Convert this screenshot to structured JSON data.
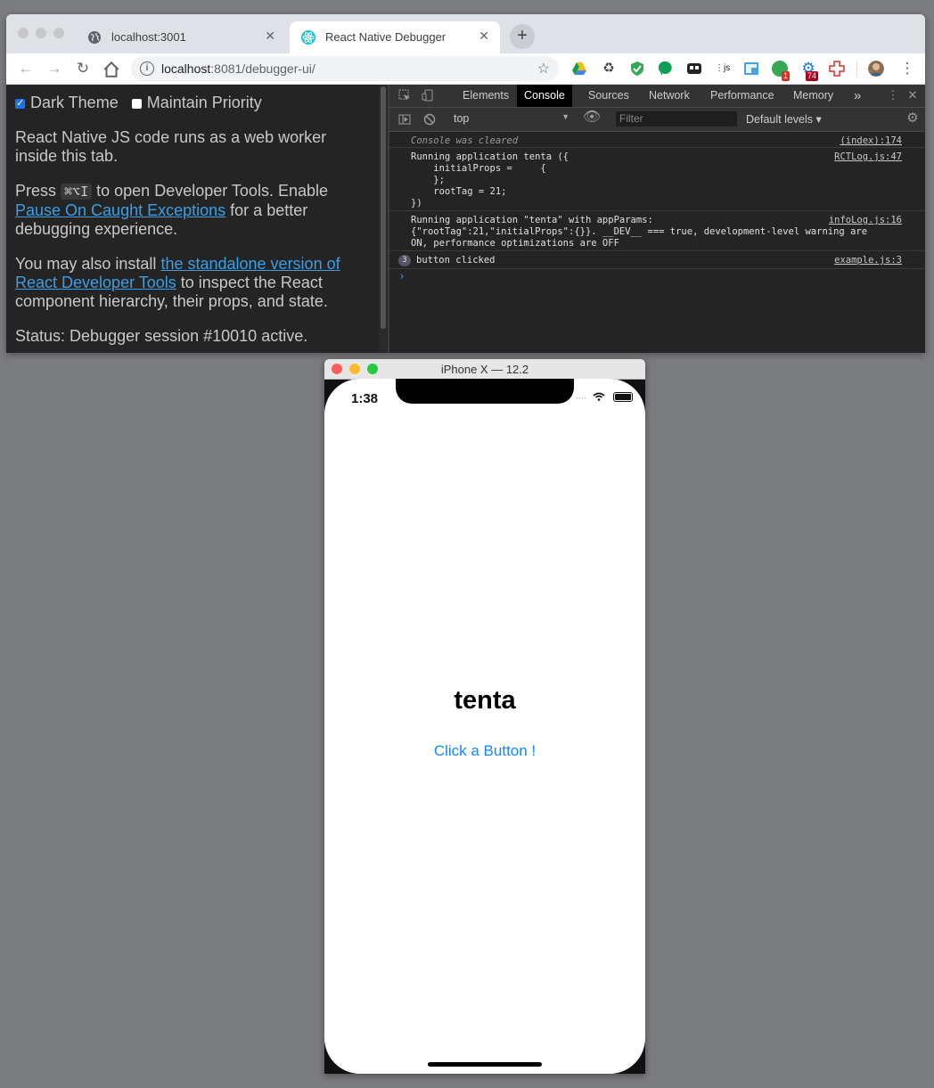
{
  "browser": {
    "tabs": [
      {
        "title": "localhost:3001",
        "icon": "globe-icon"
      },
      {
        "title": "React Native Debugger",
        "icon": "react-icon",
        "active": true
      }
    ],
    "new_tab": "+",
    "address": {
      "host": "localhost",
      "path": ":8081/debugger-ui/"
    },
    "extension_badges": [
      "1",
      "74"
    ]
  },
  "debugger_page": {
    "dark_theme_label": "Dark Theme",
    "maintain_priority_label": "Maintain Priority",
    "intro": "React Native JS code runs as a web worker inside this tab.",
    "press_prefix": "Press",
    "shortcut": "⌘⌥I",
    "press_middle": "to open Developer Tools. Enable",
    "pause_link": "Pause On Caught Exceptions",
    "press_suffix": "for a better debugging experience.",
    "install_prefix": "You may also install",
    "standalone_link": "the standalone version of React Developer Tools",
    "install_suffix": "to inspect the React component hierarchy, their props, and state.",
    "status": "Status: Debugger session #10010 active."
  },
  "devtools": {
    "tabs": [
      "Elements",
      "Console",
      "Sources",
      "Network",
      "Performance",
      "Memory"
    ],
    "more": "»",
    "context": "top",
    "filter_placeholder": "Filter",
    "levels": "Default levels ▾",
    "messages": [
      {
        "text": "Console was cleared",
        "source": "(index):174"
      },
      {
        "text": "Running application tenta ({\n    initialProps =     {\n    };\n    rootTag = 21;\n})",
        "source": "RCTLog.js:47"
      },
      {
        "text": "Running application \"tenta\" with appParams:\n{\"rootTag\":21,\"initialProps\":{}}. __DEV__ === true, development-level warning are\nON, performance optimizations are OFF",
        "source": "infoLog.js:16"
      },
      {
        "text": "button clicked",
        "source": "example.js:3",
        "count": "3"
      }
    ],
    "prompt": "›"
  },
  "simulator": {
    "title": "iPhone X — 12.2",
    "time": "1:38",
    "app_title": "tenta",
    "button_label": "Click a Button !"
  },
  "colors": {
    "link": "#3b9fe6",
    "ios_button": "#1486ff",
    "close_light": "#fc5f57",
    "minimize_light": "#fdbc2e",
    "zoom_light": "#28c840"
  }
}
